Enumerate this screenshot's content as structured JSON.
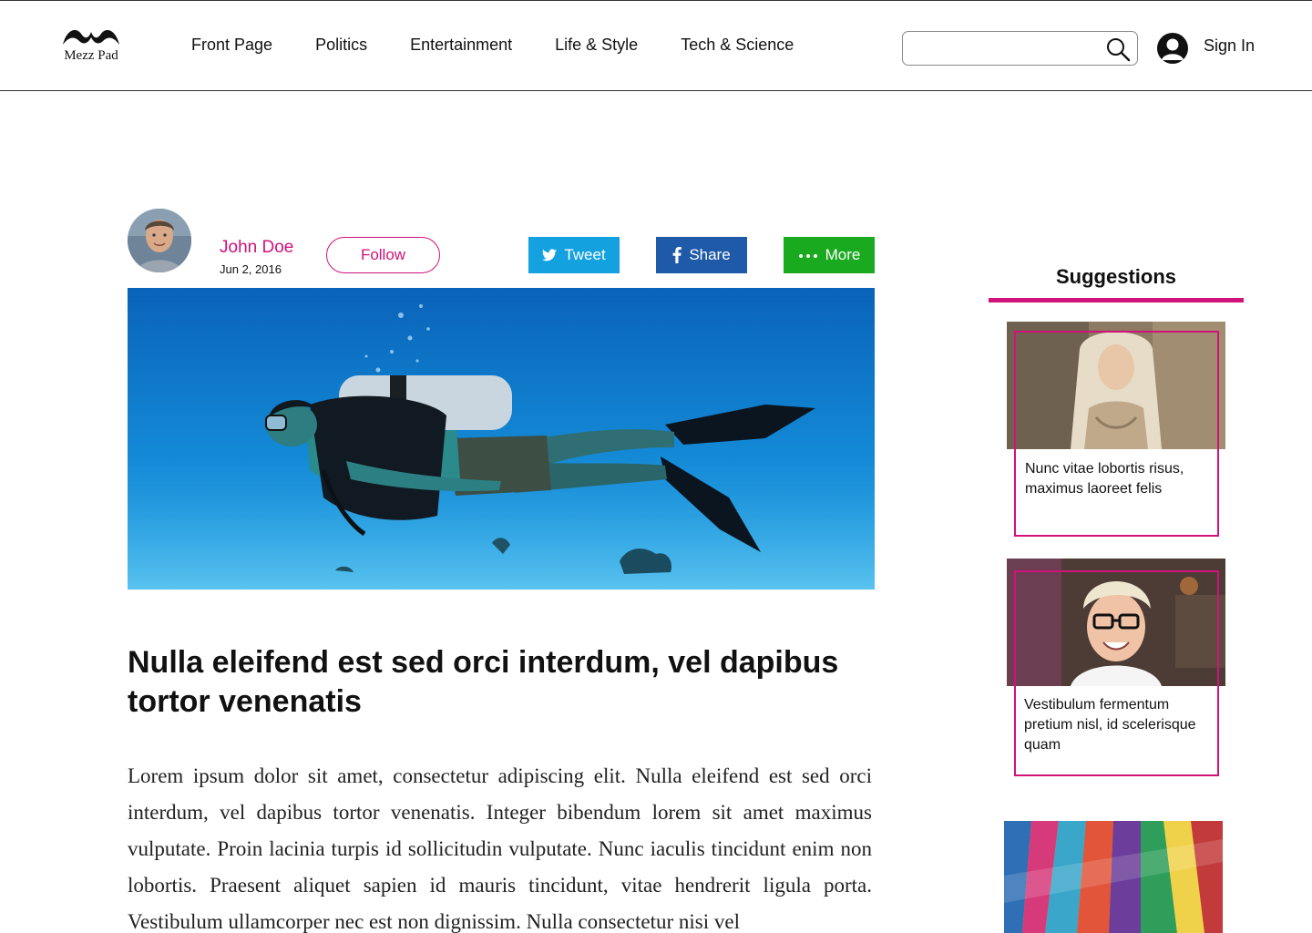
{
  "header": {
    "logo_text": "Mezz Pad",
    "nav": [
      "Front Page",
      "Politics",
      "Entertainment",
      "Life & Style",
      "Tech & Science"
    ],
    "search_value": "",
    "search_placeholder": "",
    "sign_in": "Sign In"
  },
  "article": {
    "author": "John Doe",
    "date": "Jun 2, 2016",
    "follow_label": "Follow",
    "tweet_label": "Tweet",
    "share_label": "Share",
    "more_label": "More",
    "title": "Nulla eleifend est sed orci interdum, vel dapibus tortor venenatis",
    "body": "Lorem ipsum dolor sit amet, consectetur adipiscing elit. Nulla eleifend est sed orci interdum, vel dapibus tortor venenatis. Integer bibendum lorem sit amet maximus vulputate. Proin lacinia turpis id sollicitudin vulputate. Nunc iaculis tincidunt enim non lobortis. Praesent aliquet sapien id mauris tincidunt, vitae hendrerit ligula porta. Vestibulum ullamcorper nec est non dignissim. Nulla consectetur nisi vel"
  },
  "sidebar": {
    "title": "Suggestions",
    "cards": [
      {
        "text": "Nunc vitae lobortis risus, maximus laoreet felis"
      },
      {
        "text": "Vestibulum fermentum pretium nisl, id scelerisque quam"
      }
    ]
  },
  "colors": {
    "accent": "#d1127a",
    "twitter": "#13a1e0",
    "facebook": "#1e5aa8",
    "more": "#1aaa1f"
  },
  "icons": [
    "mustache-logo-icon",
    "search-icon",
    "user-icon",
    "twitter-icon",
    "facebook-icon",
    "dots-icon"
  ]
}
